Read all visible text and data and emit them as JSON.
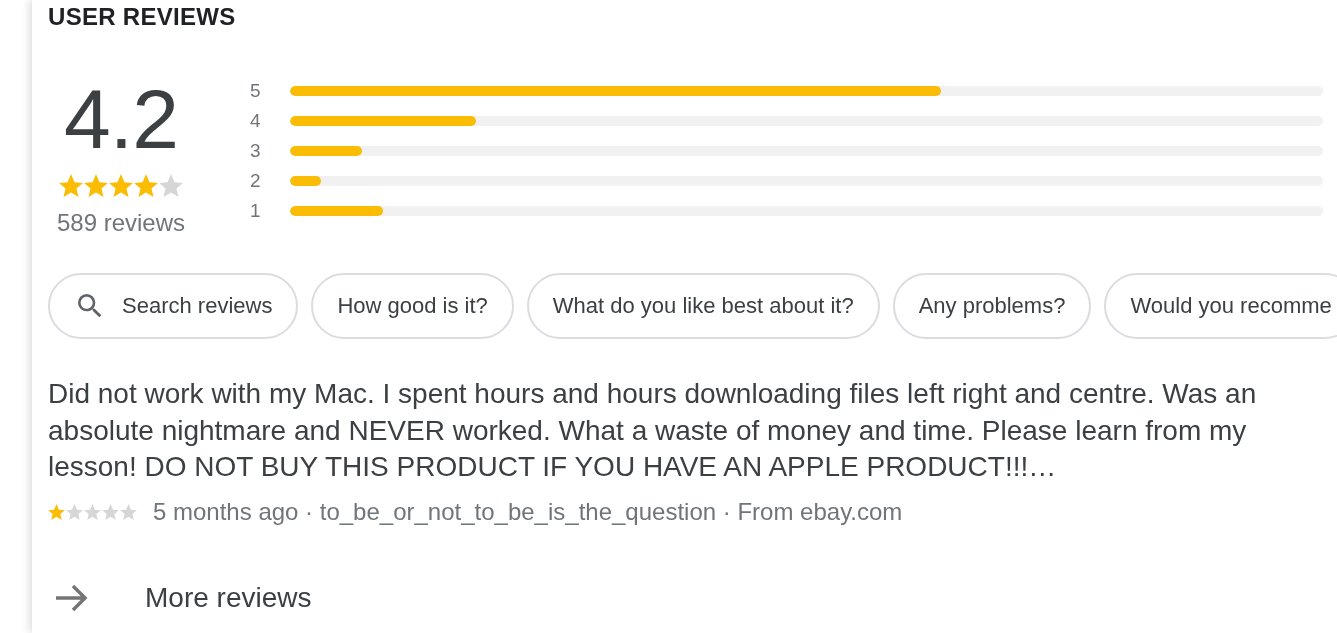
{
  "section": {
    "title": "USER REVIEWS"
  },
  "summary": {
    "rating": "4.2",
    "stars": 4,
    "count": "589 reviews"
  },
  "histogram": [
    {
      "label": "5",
      "level": 0.63
    },
    {
      "label": "4",
      "level": 0.18
    },
    {
      "label": "3",
      "level": 0.07
    },
    {
      "label": "2",
      "level": 0.03
    },
    {
      "label": "1",
      "level": 0.09
    }
  ],
  "chips": [
    {
      "kind": "search",
      "label": "Search reviews"
    },
    {
      "kind": "question",
      "label": "How good is it?"
    },
    {
      "kind": "question",
      "label": "What do you like best about it?"
    },
    {
      "kind": "question",
      "label": "Any problems?"
    },
    {
      "kind": "question",
      "label": "Would you recomme"
    }
  ],
  "reviews": [
    {
      "text": "Did not work with my Mac. I spent hours and hours downloading files left right and centre. Was an absolute nightmare and NEVER worked. What a waste of money and time. Please learn from my lesson! DO NOT BUY THIS PRODUCT IF YOU HAVE AN APPLE PRODUCT!!!…",
      "stars": 1,
      "meta": "5 months ago · to_be_or_not_to_be_is_the_question · From ebay.com"
    }
  ],
  "more_link": {
    "label": "More reviews"
  }
}
